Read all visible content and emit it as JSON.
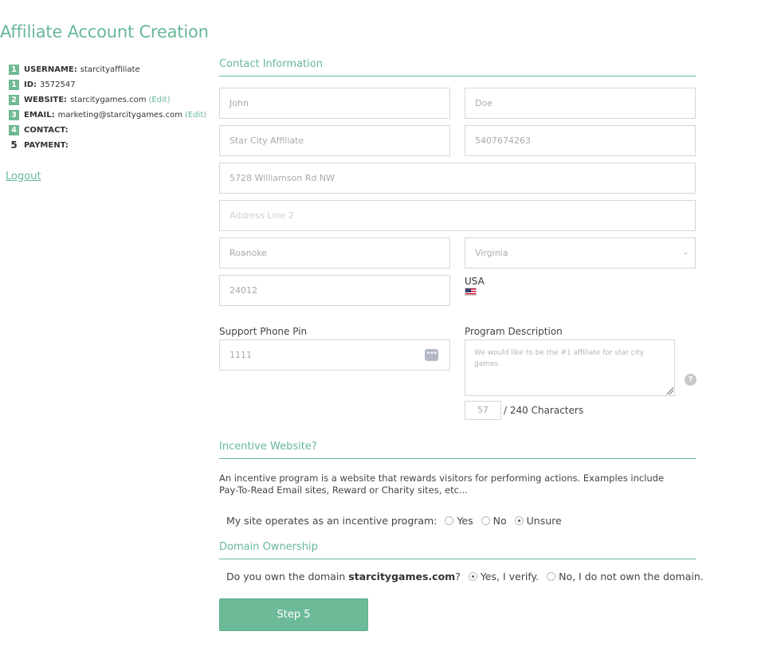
{
  "page": {
    "title": "Affiliate Account Creation"
  },
  "steps": [
    {
      "num": "1",
      "key": "USERNAME:",
      "value": "starcityaffiliate",
      "done": true,
      "edit": ""
    },
    {
      "num": "1",
      "key": "ID:",
      "value": "3572547",
      "done": true,
      "edit": ""
    },
    {
      "num": "2",
      "key": "WEBSITE:",
      "value": "starcitygames.com",
      "done": true,
      "edit": "(Edit)"
    },
    {
      "num": "3",
      "key": "EMAIL:",
      "value": "marketing@starcitygames.com",
      "done": true,
      "edit": "(Edit)"
    },
    {
      "num": "4",
      "key": "CONTACT:",
      "value": "",
      "done": true,
      "edit": ""
    },
    {
      "num": "5",
      "key": "PAYMENT:",
      "value": "",
      "done": false,
      "edit": ""
    }
  ],
  "logout": "Logout",
  "contact": {
    "section_title": "Contact Information",
    "first_name": "John",
    "last_name": "Doe",
    "company": "Star City Affiliate",
    "phone": "5407674263",
    "address1": "5728 Williamson Rd NW",
    "address2_placeholder": "Address Line 2",
    "city": "Roanoke",
    "state": "Virginia",
    "zip": "24012",
    "country": "USA"
  },
  "support_pin": {
    "label": "Support Phone Pin",
    "value": "1111"
  },
  "program": {
    "label": "Program Description",
    "placeholder": "We would like to be the #1 affiliate for star city games.",
    "count": "57",
    "count_label": "/ 240 Characters",
    "help": "?"
  },
  "incentive": {
    "section_title": "Incentive Website?",
    "description": "An incentive program is a website that rewards visitors for performing actions. Examples include Pay-To-Read Email sites, Reward or Charity sites, etc...",
    "question": "My site operates as an incentive program:",
    "options": [
      "Yes",
      "No",
      "Unsure"
    ],
    "selected": "Unsure"
  },
  "domain": {
    "section_title": "Domain Ownership",
    "question_prefix": "Do you own the domain",
    "domain": "starcitygames.com",
    "question_suffix": "?",
    "options": [
      "Yes, I verify.",
      "No, I do not own the domain."
    ],
    "selected": "Yes, I verify."
  },
  "submit": {
    "label": "Step 5"
  },
  "colors": {
    "accent": "#67b896",
    "button": "#6cba98",
    "border": "#d6d6d6"
  }
}
